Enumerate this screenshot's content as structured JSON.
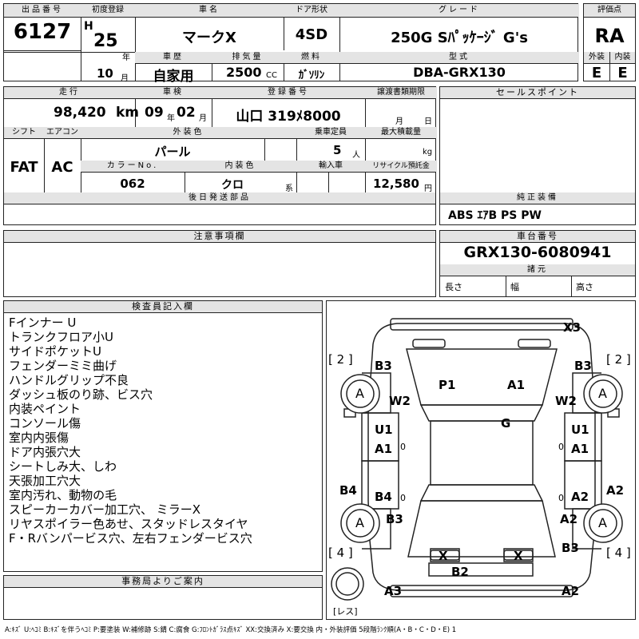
{
  "header": {
    "lot_label": "出品番号",
    "lot": "6127",
    "first_reg_label": "初度登録",
    "era": "H",
    "year": "25",
    "year_unit": "年",
    "car_name_label": "車名",
    "car_name": "マークX",
    "door_label": "ドア形状",
    "door": "4SD",
    "grade_label": "グレード",
    "grade": "250G Sﾊﾟｯｹｰｼﾞ G's",
    "score_label": "評価点",
    "score": "RA",
    "month": "10",
    "month_unit": "月",
    "history_label": "車歴",
    "history": "自家用",
    "displacement_label": "排気量",
    "displacement": "2500",
    "cc": "CC",
    "fuel_label": "燃料",
    "fuel": "ｶﾞｿﾘﾝ",
    "model_label": "型式",
    "model": "DBA-GRX130",
    "ext_label": "外装",
    "ext": "E",
    "int_label": "内装",
    "int": "E"
  },
  "row2": {
    "mileage_label": "走行",
    "mileage": "98,420",
    "mileage_unit": "km",
    "inspection_label": "車検",
    "insp_year": "09",
    "insp_y": "年",
    "insp_month": "02",
    "insp_m": "月",
    "plate_label": "登録番号",
    "plate": "山口 319ﾒ8000",
    "transfer_label": "譲渡書類期限",
    "transfer_m": "月",
    "transfer_d": "日",
    "shift_label": "シフト",
    "shift": "FAT",
    "aircon_label": "エアコン",
    "aircon": "AC",
    "color_label": "外装色",
    "color": "パール",
    "capacity_label": "乗車定員",
    "capacity": "5",
    "capacity_unit": "人",
    "load_label": "最大積載量",
    "load_unit": "kg",
    "color_no_label": "カラーNo.",
    "color_no": "062",
    "int_color_label": "内装色",
    "int_color": "クロ",
    "int_color_unit": "系",
    "import_label": "輸入車",
    "recycle_label": "リサイクル預託金",
    "recycle": "12,580",
    "recycle_unit": "円",
    "later_parts_label": "後日発送部品"
  },
  "right": {
    "sales_point_label": "セールスポイント",
    "genuine_label": "純正装備",
    "genuine": "ABS ｴｱB PS PW",
    "chassis_label": "車台番号",
    "chassis": "GRX130-6080941",
    "specs_label": "諸元",
    "length": "長さ",
    "width": "幅",
    "height": "高さ"
  },
  "caution_label": "注意事項欄",
  "inspector_label": "検査員記入欄",
  "notes": [
    "Fインナー U",
    "トランクフロア小U",
    "サイドポケットU",
    "フェンダーミミ曲げ",
    "ハンドルグリップ不良",
    "ダッシュ板のり跡、ビス穴",
    "内装ペイント",
    "コンソール傷",
    "室内内張傷",
    "ドア内張穴大",
    "シートしみ大、しわ",
    "天張加工穴大",
    "室内汚れ、動物の毛",
    "スピーカーカバー加工穴、 ミラーX",
    "リヤスポイラー色あせ、スタッドレスタイヤ",
    "F・Rバンパービス穴、左右フェンダービス穴"
  ],
  "office_label": "事務局よりご案内",
  "diagram": {
    "labels": {
      "x3": "X3",
      "b3l": "B3",
      "b3r": "B3",
      "w2l": "W2",
      "w2r": "W2",
      "p1": "P1",
      "a1top": "A1",
      "g": "G",
      "u1l": "U1",
      "u1r": "U1",
      "a1l": "A1",
      "a1r": "A1",
      "b4side": "B4",
      "b4": "B4",
      "a2side": "A2",
      "a2": "A2",
      "b3bl": "B3",
      "b3br": "B3",
      "b2": "B2",
      "a3": "A3",
      "a2b": "A2",
      "xl": "X",
      "xr": "X",
      "o1": "0",
      "o2": "0",
      "o3": "0",
      "o4": "0"
    },
    "tires": {
      "fl": "A",
      "fr": "A",
      "rl": "A",
      "rr": "A"
    },
    "brackets": {
      "tl": "[ 2 ]",
      "tr": "[ 2 ]",
      "bl": "[ 4 ]",
      "br": "[ 4 ]",
      "spare": "[レス]"
    }
  },
  "legend": "A:ｷｽﾞ U:ﾍｺﾐ B:ｷｽﾞを伴うﾍｺﾐ P:要塗装 W:補修跡 S:錆 C:腐食 G:ﾌﾛﾝﾄｶﾞﾗｽ点ｷｽﾞ XX:交換済み X:要交換 内・外装評価 5段階ﾗﾝｸ順(A・B・C・D・E) 1"
}
